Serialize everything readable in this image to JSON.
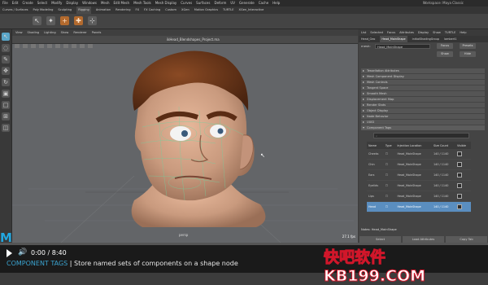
{
  "menubar": {
    "items": [
      "File",
      "Edit",
      "Create",
      "Select",
      "Modify",
      "Display",
      "Windows",
      "Mesh",
      "Edit Mesh",
      "Mesh Tools",
      "Mesh Display",
      "Curves",
      "Surfaces",
      "Deform",
      "UV",
      "Generate",
      "Cache",
      "Help"
    ],
    "title": "Workspace: Maya Classic"
  },
  "shelf": {
    "tabs": [
      "Curves / Surfaces",
      "Poly Modeling",
      "Sculpting",
      "Rigging",
      "Animation",
      "Rendering",
      "FX",
      "FX Caching",
      "Custom",
      "XGen",
      "Motion Graphics",
      "TURTLE",
      "XGen_Interactive"
    ],
    "active_tab": "Rigging"
  },
  "viewport": {
    "menu": [
      "View",
      "Shading",
      "Lighting",
      "Show",
      "Renderer",
      "Panels"
    ],
    "file_label": "ikHead_Blendshapes_Project.ma",
    "camera_label": "persp",
    "fps": "27.1 fps"
  },
  "panel": {
    "menu": [
      "List",
      "Selected",
      "Focus",
      "Attributes",
      "Display",
      "Show",
      "TURTLE",
      "Help"
    ],
    "tabs": [
      "Head_Geo",
      "Head_MainShape",
      "initialShadingGroup",
      "lambert1"
    ],
    "active_tab": "Head_MainShape",
    "field_label": "mesh:",
    "field_value": "Head_MainShape",
    "buttons": {
      "focus": "Focus",
      "presets": "Presets",
      "show": "Show",
      "hide": "Hide"
    },
    "sections": [
      "Tessellation Attributes",
      "Mesh Component Display",
      "Mesh Controls",
      "Tangent Space",
      "Smooth Mesh",
      "Displacement Map",
      "Render Stats",
      "Object Display",
      "Node Behavior",
      "UUID",
      "Component Tags"
    ],
    "open_section": "Component Tags",
    "component_tags": {
      "columns": [
        "Name",
        "Type",
        "Injection Location",
        "Size Count",
        "Visible"
      ],
      "rows": [
        {
          "name": "Cheeks",
          "type": "☐",
          "location": "Head_MainShape",
          "size": "140 / 1140"
        },
        {
          "name": "Chin",
          "type": "☐",
          "location": "Head_MainShape",
          "size": "140 / 1140"
        },
        {
          "name": "Ears",
          "type": "☐",
          "location": "Head_MainShape",
          "size": "140 / 1140"
        },
        {
          "name": "Eyelids",
          "type": "☐",
          "location": "Head_MainShape",
          "size": "140 / 1140"
        },
        {
          "name": "Lips",
          "type": "☐",
          "location": "Head_MainShape",
          "size": "140 / 1140"
        },
        {
          "name": "Head",
          "type": "☐",
          "location": "Head_MainShape",
          "size": "140 / 1140"
        }
      ],
      "selected_row": 5
    },
    "notes_label": "Notes: Head_MainShape",
    "bottom_buttons": [
      "Select",
      "Load Attributes",
      "Copy Tab"
    ]
  },
  "video": {
    "progress": 0.0,
    "time": "0:00 / 8:40",
    "caption_topic": "COMPONENT TAGS",
    "caption_sep": " | ",
    "caption_text": "Store named sets of components on a shape node"
  },
  "watermark": "快吧软件 KB199.COM",
  "brand_colors": {
    "progress": "#e34234",
    "caption_topic": "#3aa3d0",
    "watermark_stroke": "#d1162a",
    "selection": "#5a8ec0"
  }
}
